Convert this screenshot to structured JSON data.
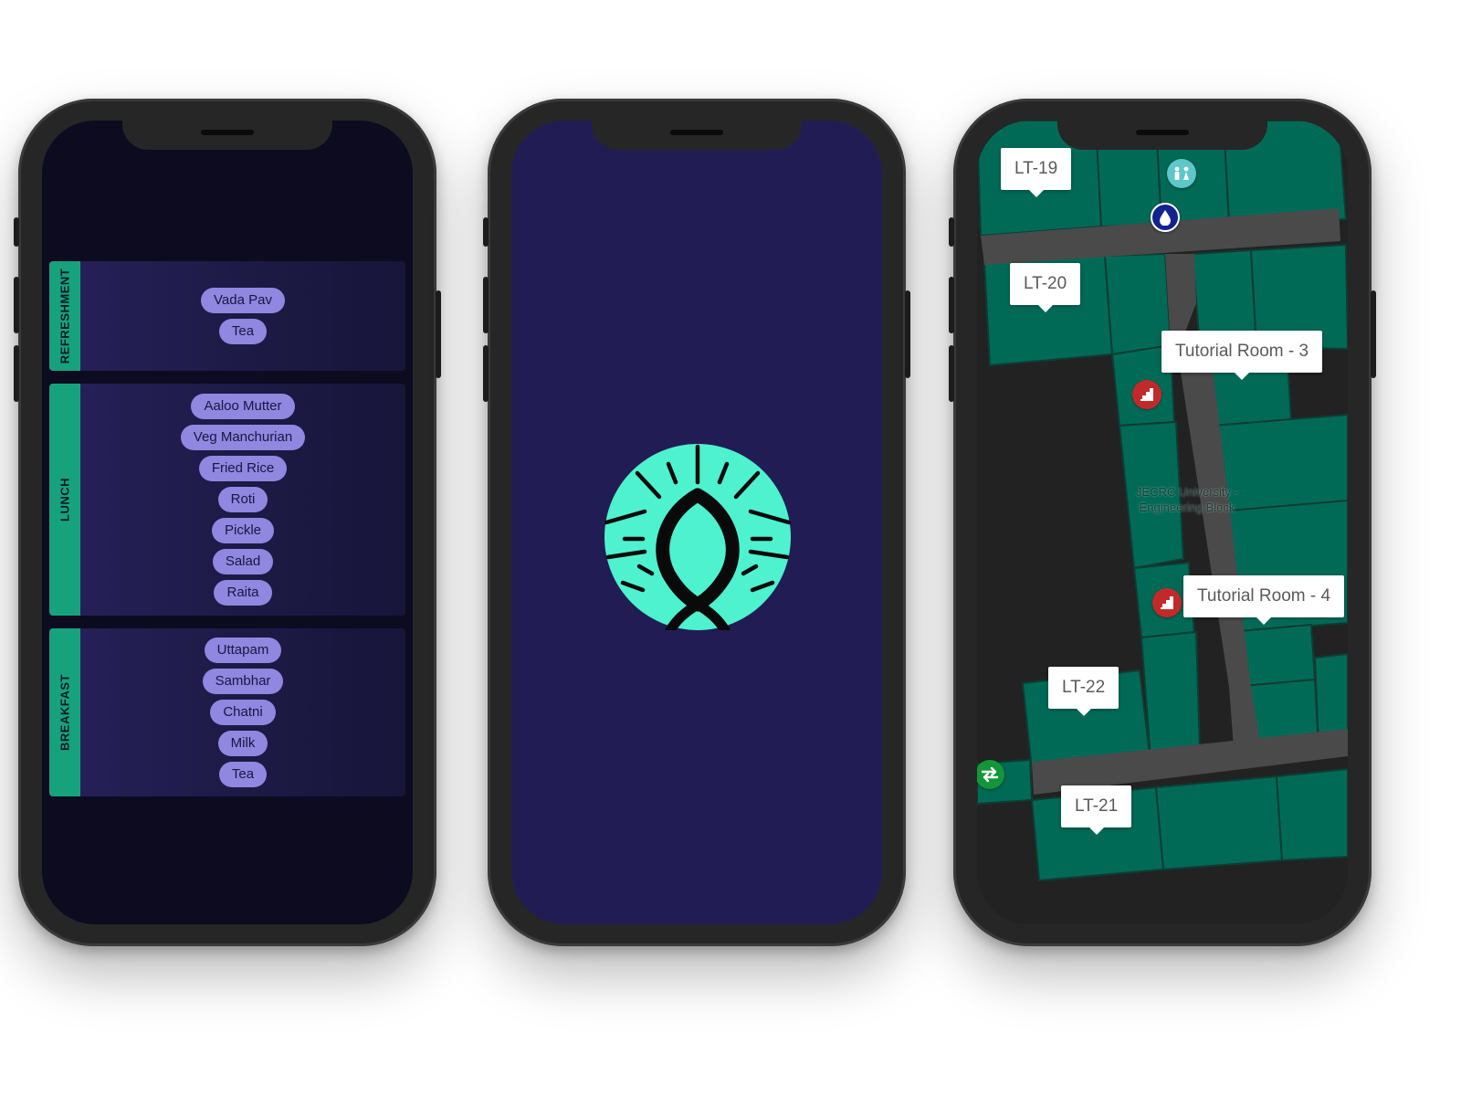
{
  "menu": {
    "meals": [
      {
        "name": "REFRESHMENT",
        "items": [
          "Vada Pav",
          "Tea"
        ]
      },
      {
        "name": "LUNCH",
        "items": [
          "Aaloo Mutter",
          "Veg Manchurian",
          "Fried Rice",
          "Roti",
          "Pickle",
          "Salad",
          "Raita"
        ]
      },
      {
        "name": "BREAKFAST",
        "items": [
          "Uttapam",
          "Sambhar",
          "Chatni",
          "Milk",
          "Tea"
        ]
      }
    ]
  },
  "splash": {
    "logo_icon": "lightbulb-drop-logo-icon",
    "logo_color": "#4ef2cf",
    "background": "#211d54"
  },
  "map": {
    "building_label": "JECRC University - Engineering Block",
    "callouts": {
      "lt19": "LT-19",
      "lt20": "LT-20",
      "tutorial3": "Tutorial Room - 3",
      "tutorial4": "Tutorial Room - 4",
      "lt22": "LT-22",
      "lt21": "LT-21"
    },
    "icons": [
      "restroom-icon",
      "water-drop-icon",
      "stairs-icon",
      "exit-icon"
    ],
    "room_color": "#006a57",
    "corridor_color": "#4a4a4a"
  }
}
